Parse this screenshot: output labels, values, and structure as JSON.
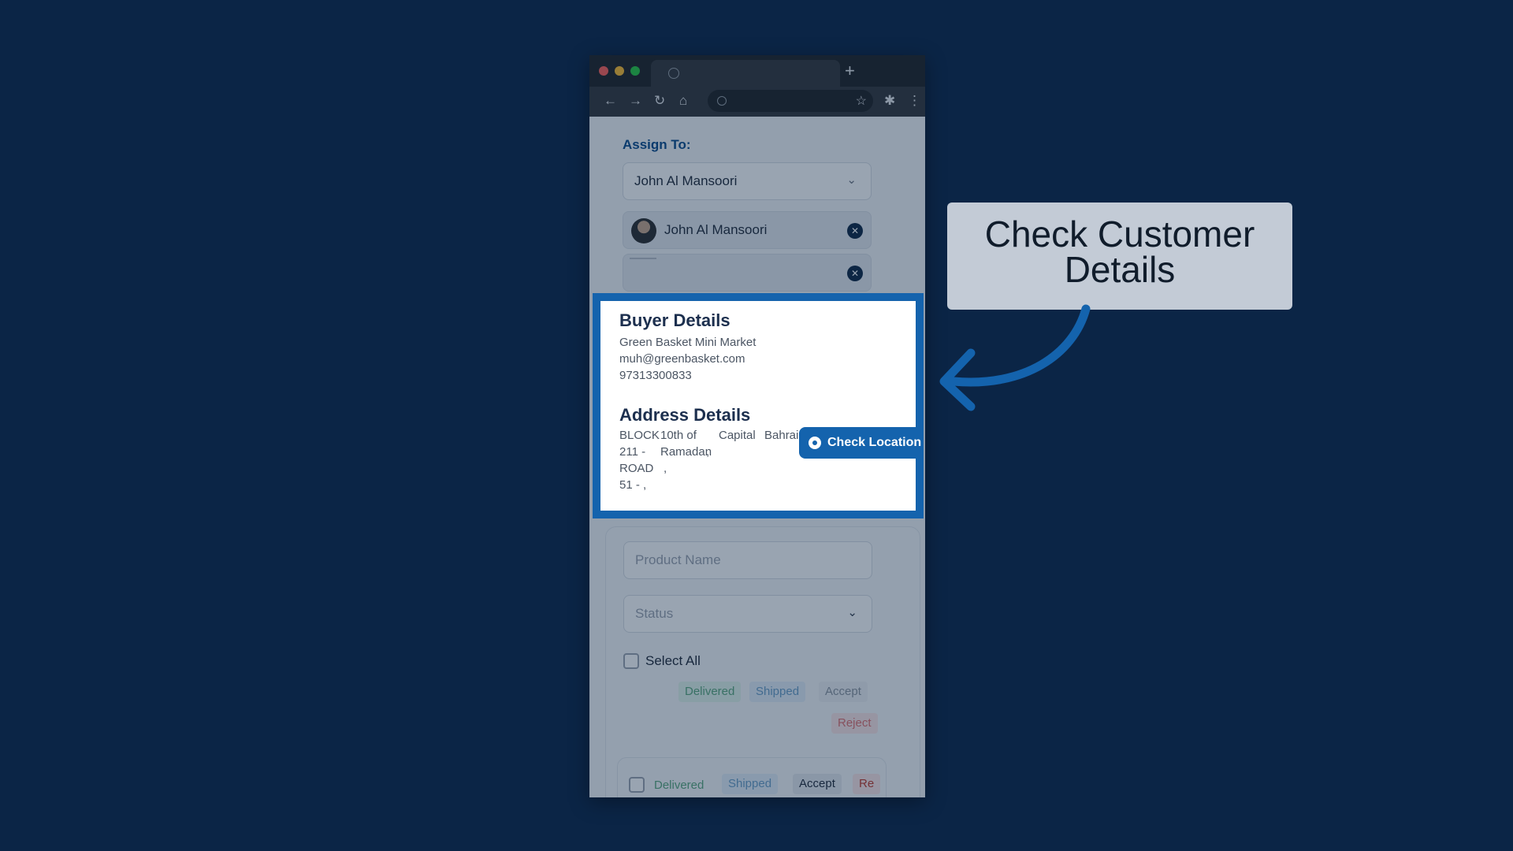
{
  "browser": {
    "new_tab_symbol": "+",
    "traffic_colors": {
      "close": "#ff5f57",
      "minimize": "#febc2e",
      "maximize": "#28c840"
    },
    "toolbar_icons": [
      "back-arrow-icon",
      "forward-arrow-icon",
      "reload-icon",
      "home-icon",
      "globe-icon",
      "bookmark-star-icon",
      "extensions-icon",
      "menu-dots-icon"
    ]
  },
  "form": {
    "assign_label": "Assign To:",
    "assign_select_value": "John Al Mansoori",
    "chip_name": "John Al Mansoori"
  },
  "buyer": {
    "title": "Buyer Details",
    "name": "Green Basket Mini Market",
    "email": "muh@greenbasket.com",
    "phone": "97313300833"
  },
  "address": {
    "title": "Address Details",
    "col1": [
      "BLOCK",
      "211 -",
      "ROAD",
      "51 - ,"
    ],
    "col2": [
      "10th of",
      "Ramadan",
      ","
    ],
    "col3": [
      "Capital",
      ","
    ],
    "col4": [
      "Bahrain"
    ],
    "check_location_label": "Check Location"
  },
  "products": {
    "product_name_placeholder": "Product Name",
    "status_placeholder": "Status",
    "select_all_label": "Select All",
    "actions": {
      "delivered": "Delivered",
      "shipped": "Shipped",
      "accept": "Accept",
      "reject": "Reject"
    },
    "row_actions": {
      "delivered": "Delivered",
      "shipped": "Shipped",
      "accept": "Accept",
      "reject": "Re"
    }
  },
  "callout": {
    "line1": "Check Customer",
    "line2": "Details"
  },
  "colors": {
    "background": "#0b2546",
    "highlight": "#1463ad",
    "callout_bg": "#c3cbd6"
  }
}
